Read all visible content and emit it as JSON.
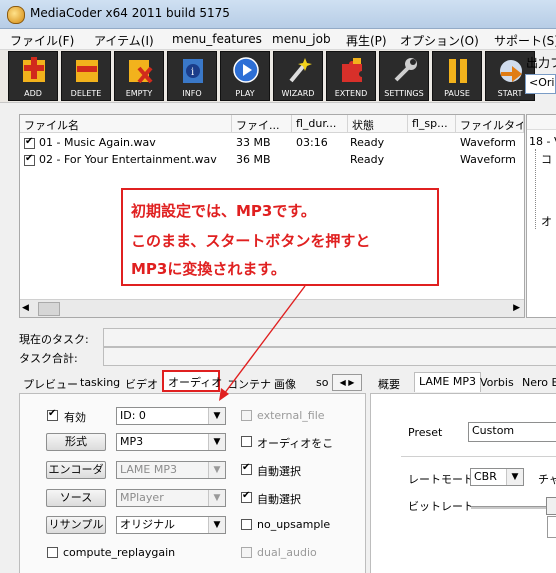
{
  "window": {
    "title": "MediaCoder x64 2011 build 5175"
  },
  "menu": [
    "ファイル(F)",
    "アイテム(I)",
    "menu_features",
    "menu_job",
    "再生(P)",
    "オプション(O)",
    "サポート(S)"
  ],
  "toolbar": [
    "ADD",
    "DELETE",
    "EMPTY",
    "INFO",
    "PLAY",
    "WIZARD",
    "EXTEND",
    "SETTINGS",
    "PAUSE",
    "START"
  ],
  "output_label": "出力フ",
  "output_combo": "<Origi",
  "file_list": {
    "columns": [
      "ファイル名",
      "ファイ...",
      "fl_dur...",
      "状態",
      "fl_sp...",
      "ファイルタイプ"
    ],
    "rows": [
      {
        "name": "01 - Music Again.wav",
        "size": "33 MB",
        "duration": "03:16",
        "status": "Ready",
        "type": "Waveform",
        "checked": true
      },
      {
        "name": "02 - For Your Entertainment.wav",
        "size": "36 MB",
        "duration": "",
        "status": "Ready",
        "type": "Waveform",
        "checked": true
      }
    ]
  },
  "right_tree": {
    "item": "18 - V",
    "child1": "コ",
    "child2": "オ"
  },
  "callout": [
    "初期設定では、MP3です。",
    "このまま、スタートボタンを押すと",
    "MP3に変換されます。"
  ],
  "status": {
    "current_task": "現在のタスク:",
    "total_tasks": "タスク合計:"
  },
  "left_tabs": [
    "プレビュー",
    "tasking",
    "ビデオ",
    "オーディオ",
    "コンテナ",
    "画像",
    "so"
  ],
  "right_tabs": [
    "概要",
    "LAME MP3",
    "Vorbis",
    "Nero E"
  ],
  "audio": {
    "enable_label": "有効",
    "enable_checked": true,
    "id_value": "ID: 0",
    "format_btn": "形式",
    "format_value": "MP3",
    "encoder_btn": "エンコーダ",
    "encoder_value": "LAME MP3",
    "source_btn": "ソース",
    "source_value": "MPlayer",
    "resample_btn": "リサンプル",
    "resample_value": "オリジナル",
    "compute_replaygain": "compute_replaygain",
    "external_file": "external_file",
    "audio_to": "オーディオをこ",
    "auto_select_1": "自動選択",
    "auto_select_2": "自動選択",
    "no_upsample": "no_upsample",
    "dual_audio": "dual_audio"
  },
  "lame": {
    "preset_label": "Preset",
    "preset_value": "Custom",
    "rate_mode_label": "レートモード",
    "rate_mode_value": "CBR",
    "channel_label": "チャ",
    "bitrate_label": "ビットレート"
  }
}
